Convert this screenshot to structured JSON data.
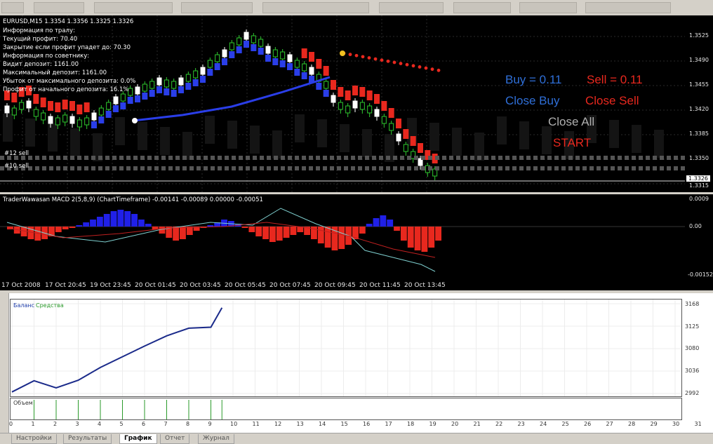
{
  "chart": {
    "header": "EURUSD,M15  1.3354 1.3356 1.3325 1.3326",
    "info_lines": [
      "Информация по тралу:",
      "Текущий профит: 70.40",
      "Закрытие если профит упадет до: 70.30",
      "Информация по советнику:",
      "Видит депозит: 1161.00",
      "Максимальный депозит: 1161.00",
      "Убыток от максимального депозита: 0.0%",
      "Профит от начального депозита: 16.1%"
    ],
    "order_labels": [
      "#12 sell",
      "#10 sell"
    ],
    "price_ticks": [
      "1.3525",
      "1.3490",
      "1.3455",
      "1.3420",
      "1.3385",
      "1.3350",
      "1.3315"
    ],
    "current_price": "1.3326"
  },
  "controls": {
    "buy": "Buy = 0.11",
    "sell": "Sell = 0.11",
    "close_buy": "Close Buy",
    "close_sell": "Close Sell",
    "close_all": "Close All",
    "start": "START",
    "colors": {
      "blue": "#2f6fd8",
      "red": "#e8281e",
      "gray": "#b0b0b0"
    }
  },
  "macd": {
    "header": "TraderWawasan MACD 2(5,8,9) (ChartTimeframe) -0.00141 -0.00089 0.00000 -0.00051",
    "ticks": [
      "0.0009",
      "0.00",
      "-0.00152"
    ]
  },
  "time_axis": [
    "17 Oct 2008",
    "17 Oct 20:45",
    "19 Oct 23:45",
    "20 Oct 01:45",
    "20 Oct 03:45",
    "20 Oct 05:45",
    "20 Oct 07:45",
    "20 Oct 09:45",
    "20 Oct 11:45",
    "20 Oct 13:45"
  ],
  "tester": {
    "legend_balance": "Баланс",
    "legend_equity": "Средства",
    "y_ticks": [
      "3168",
      "3125",
      "3080",
      "3036",
      "2992"
    ],
    "volume_label": "Объем",
    "x_ticks": [
      "0",
      "1",
      "2",
      "3",
      "4",
      "5",
      "6",
      "7",
      "8",
      "9",
      "10",
      "11",
      "12",
      "13",
      "14",
      "15",
      "16",
      "17",
      "18",
      "19",
      "20",
      "21",
      "22",
      "23",
      "24",
      "25",
      "26",
      "27",
      "28",
      "29",
      "30",
      "31"
    ],
    "balance_points": [
      [
        0,
        2995
      ],
      [
        1,
        3017
      ],
      [
        2,
        3003
      ],
      [
        3,
        3018
      ],
      [
        4,
        3043
      ],
      [
        5,
        3064
      ],
      [
        6,
        3085
      ],
      [
        7,
        3105
      ],
      [
        8,
        3120
      ],
      [
        9,
        3122
      ],
      [
        9.5,
        3160
      ]
    ],
    "volume_bars": [
      1,
      2,
      3,
      4,
      5,
      6,
      7,
      8,
      9,
      9.5
    ]
  },
  "tabs": [
    "Настройки",
    "Результаты",
    "График",
    "Отчет",
    "Журнал"
  ],
  "active_tab": "График"
}
